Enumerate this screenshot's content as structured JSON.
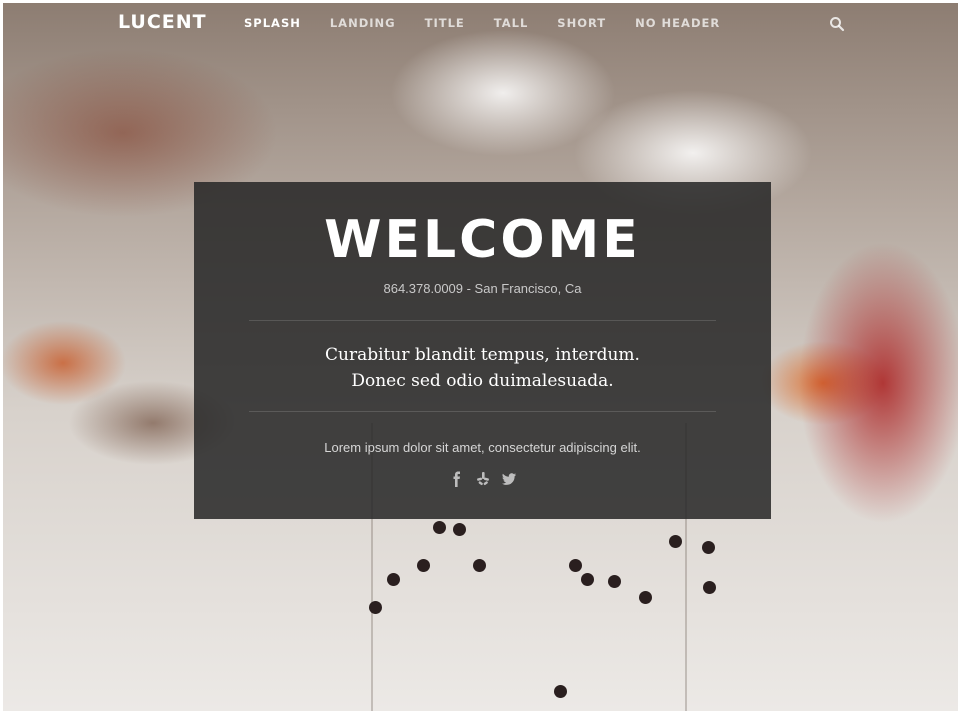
{
  "site": {
    "logo": "LUCENT"
  },
  "nav": {
    "items": [
      {
        "label": "SPLASH",
        "active": true
      },
      {
        "label": "LANDING",
        "active": false
      },
      {
        "label": "TITLE",
        "active": false
      },
      {
        "label": "TALL",
        "active": false
      },
      {
        "label": "SHORT",
        "active": false
      },
      {
        "label": "NO HEADER",
        "active": false
      }
    ],
    "search_icon": "search-icon"
  },
  "hero": {
    "title": "WELCOME",
    "contact": "864.378.0009 - San Francisco, Ca",
    "tagline_line1": "Curabitur blandit tempus, interdum.",
    "tagline_line2": "Donec sed odio duimalesuada.",
    "description": "Lorem ipsum dolor sit amet, consectetur adipiscing elit.",
    "social_icons": [
      "facebook-icon",
      "yelp-icon",
      "twitter-icon"
    ]
  }
}
